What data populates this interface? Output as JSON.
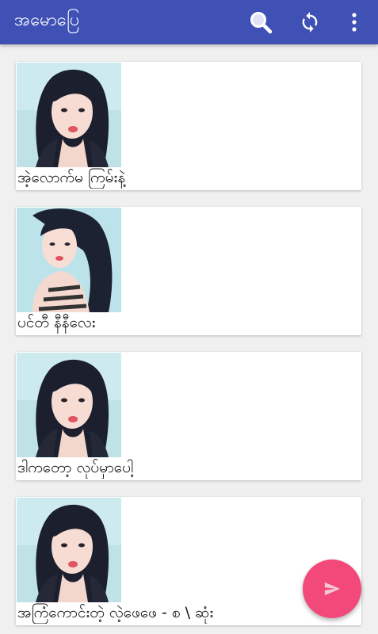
{
  "appbar": {
    "title": "အမောပြေ",
    "color": "#4051b5",
    "actions": [
      {
        "icon": "search-icon"
      },
      {
        "icon": "refresh-icon"
      },
      {
        "icon": "more-vert-icon"
      }
    ]
  },
  "posts": [
    {
      "caption": "အဲ့လောက်မ ကြမ်းနဲ့",
      "image": "girl-portrait-1"
    },
    {
      "caption": "ပင်တီ နီနီလေး",
      "image": "girl-portrait-2"
    },
    {
      "caption": "ဒါကတော့ လုပ်မှာပေါ့",
      "image": "girl-portrait-1"
    },
    {
      "caption": "အကြံကောင်းတဲ့ လဲ့ဖေဖေ - စ \\ ဆုံး",
      "image": "girl-portrait-1"
    }
  ],
  "fab": {
    "icon": "send-icon",
    "color": "#f2497a"
  }
}
